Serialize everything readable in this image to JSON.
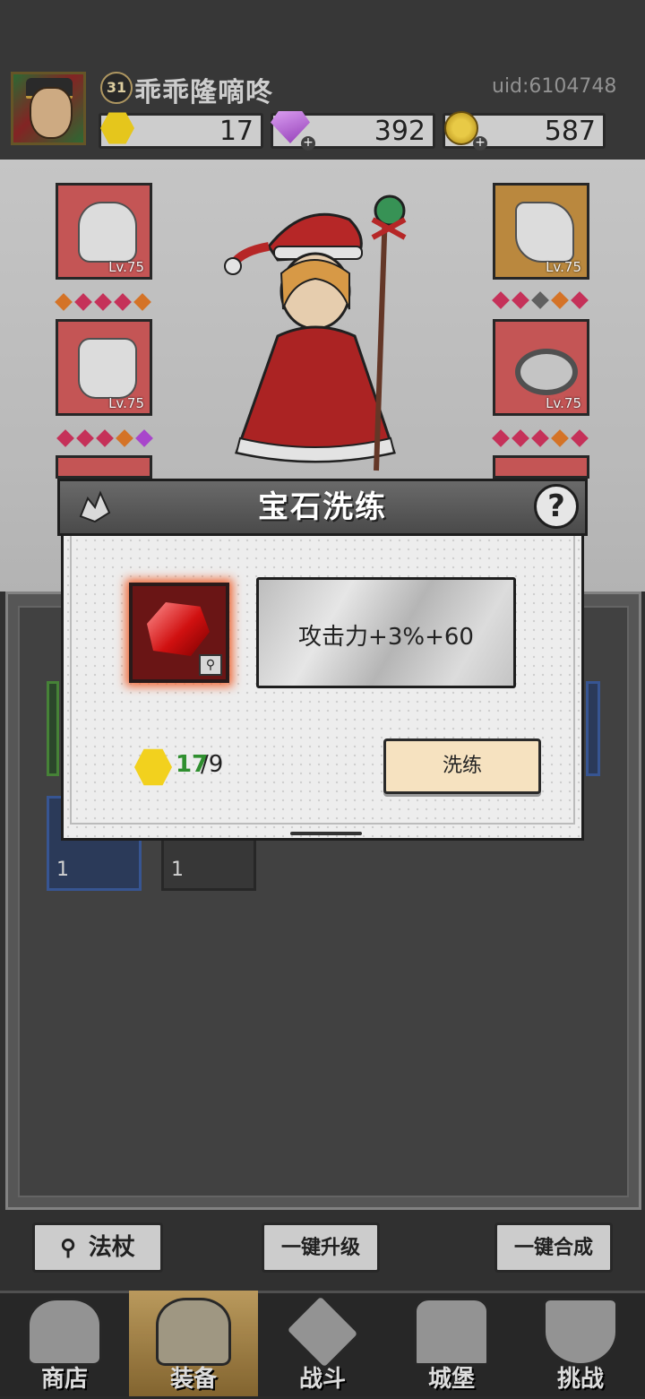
{
  "player": {
    "level": "31",
    "name": "乖乖隆嘀咚",
    "uid": "uid:6104748"
  },
  "resources": {
    "gold_gem": "17",
    "diamond": "392",
    "coin": "587"
  },
  "equipment": {
    "slots": [
      {
        "name": "hood",
        "level": "Lv.75"
      },
      {
        "name": "cape",
        "level": "Lv.75"
      },
      {
        "name": "gauntlet",
        "level": "Lv.75"
      },
      {
        "name": "ring",
        "level": "Lv.75"
      }
    ]
  },
  "gem_list": {
    "counts": [
      "1",
      "1"
    ]
  },
  "dialog": {
    "title": "宝石洗练",
    "help": "?",
    "stat": "攻击力+3%+60",
    "cost_have": "17",
    "cost_need": "/9",
    "refine_label": "洗练"
  },
  "bottom_buttons": {
    "staff_label": "法杖",
    "upgrade_label": "一键升级",
    "merge_label": "一键合成"
  },
  "nav": {
    "items": [
      {
        "label": "商店"
      },
      {
        "label": "装备"
      },
      {
        "label": "战斗"
      },
      {
        "label": "城堡"
      },
      {
        "label": "挑战"
      }
    ],
    "active_index": 1
  },
  "colors": {
    "accent_gold": "#f2d11e",
    "slot_red": "#cf5a5a",
    "slot_orange": "#c49042",
    "refine_button": "#f6e2c0",
    "cost_have": "#2f8f2f"
  }
}
